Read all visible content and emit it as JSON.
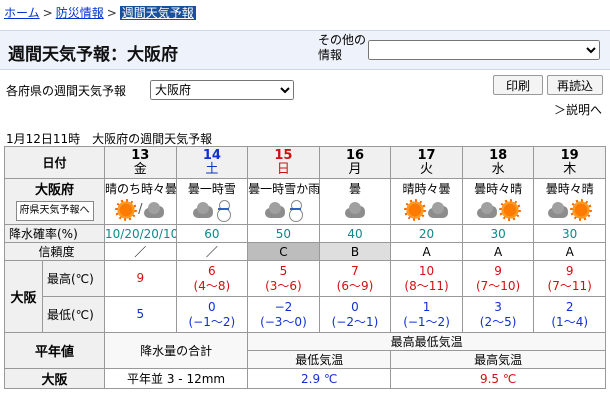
{
  "breadcrumb": {
    "home": "ホーム",
    "disaster": "防災情報",
    "current": "週間天気予報"
  },
  "header": {
    "title": "週間天気予報：大阪府",
    "other_label": "その他の情報",
    "other_value": ""
  },
  "pref": {
    "label": "各府県の週間天気予報",
    "value": "大阪府"
  },
  "toolbar": {
    "print": "印刷",
    "reload": "再読込",
    "help": "＞説明へ"
  },
  "issued": "1月12日11時　大阪府の週間天気予報",
  "table": {
    "date_label": "日付",
    "pref_name": "大阪府",
    "pref_btn": "府県天気予報へ",
    "pop_label": "降水確率(%)",
    "rel_label": "信頼度",
    "area": "大阪",
    "max_label": "最高(℃)",
    "min_label": "最低(℃)",
    "days": [
      {
        "date": "13",
        "dow": "金",
        "cls": "",
        "tel": "晴のち時々曇",
        "icons": [
          "sun",
          "/",
          "cloud"
        ],
        "pop": "10/20/20/10",
        "rel": "／",
        "relcls": "",
        "max": "9",
        "max_range": "",
        "min": "5",
        "min_range": ""
      },
      {
        "date": "14",
        "dow": "土",
        "cls": "sat",
        "tel": "曇一時雪",
        "icons": [
          "cloud",
          "snow"
        ],
        "pop": "60",
        "rel": "／",
        "relcls": "",
        "max": "6",
        "max_range": "(4〜8)",
        "min": "0",
        "min_range": "(−1〜2)"
      },
      {
        "date": "15",
        "dow": "日",
        "cls": "sun",
        "tel": "曇一時雪か雨",
        "icons": [
          "cloud",
          "snow"
        ],
        "pop": "50",
        "rel": "C",
        "relcls": "relC",
        "max": "5",
        "max_range": "(3〜6)",
        "min": "−2",
        "min_range": "(−3〜0)"
      },
      {
        "date": "16",
        "dow": "月",
        "cls": "",
        "tel": "曇",
        "icons": [
          "cloud"
        ],
        "pop": "40",
        "rel": "B",
        "relcls": "relB",
        "max": "7",
        "max_range": "(6〜9)",
        "min": "0",
        "min_range": "(−2〜1)"
      },
      {
        "date": "17",
        "dow": "火",
        "cls": "",
        "tel": "晴時々曇",
        "icons": [
          "sun",
          "cloud"
        ],
        "pop": "20",
        "rel": "A",
        "relcls": "",
        "max": "10",
        "max_range": "(8〜11)",
        "min": "1",
        "min_range": "(−1〜2)"
      },
      {
        "date": "18",
        "dow": "水",
        "cls": "",
        "tel": "曇時々晴",
        "icons": [
          "cloud",
          "sun"
        ],
        "pop": "30",
        "rel": "A",
        "relcls": "",
        "max": "9",
        "max_range": "(7〜10)",
        "min": "3",
        "min_range": "(2〜5)"
      },
      {
        "date": "19",
        "dow": "木",
        "cls": "",
        "tel": "曇時々晴",
        "icons": [
          "cloud",
          "sun"
        ],
        "pop": "30",
        "rel": "A",
        "relcls": "",
        "max": "9",
        "max_range": "(7〜11)",
        "min": "2",
        "min_range": "(1〜4)"
      }
    ]
  },
  "normals": {
    "heading": "平年値",
    "precip_label": "降水量の合計",
    "temp_heading": "最高最低気温",
    "min_label": "最低気温",
    "max_label": "最高気温",
    "area": "大阪",
    "precip_value": "平年並 3 - 12mm",
    "min_value": "2.9 ℃",
    "max_value": "9.5 ℃"
  }
}
